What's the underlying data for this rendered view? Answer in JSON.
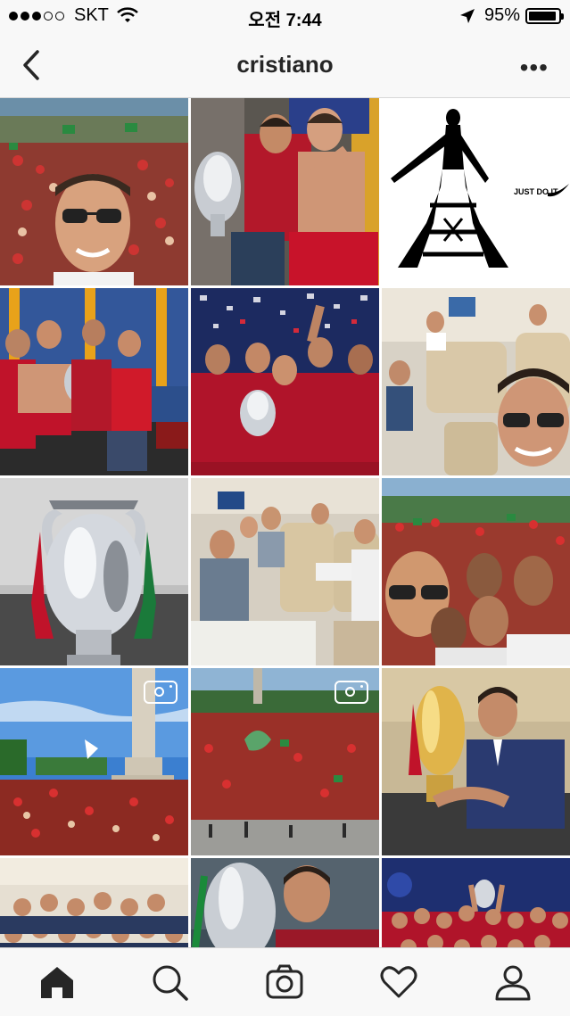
{
  "status_bar": {
    "carrier": "SKT",
    "signal_bars_filled": 3,
    "signal_bars_total": 5,
    "time": "오전 7:44",
    "battery_percent": "95%",
    "battery_level": 0.95,
    "icons": [
      "wifi-icon",
      "location-arrow-icon",
      "battery-icon"
    ]
  },
  "header": {
    "title": "cristiano",
    "back_icon": "chevron-left-icon",
    "more_label": "•••"
  },
  "grid": {
    "posts": [
      {
        "id": "post-1",
        "is_video": false
      },
      {
        "id": "post-2",
        "is_video": false
      },
      {
        "id": "post-3",
        "is_video": false,
        "caption_text": "JUST DO IT"
      },
      {
        "id": "post-4",
        "is_video": false
      },
      {
        "id": "post-5",
        "is_video": false
      },
      {
        "id": "post-6",
        "is_video": false
      },
      {
        "id": "post-7",
        "is_video": false
      },
      {
        "id": "post-8",
        "is_video": false
      },
      {
        "id": "post-9",
        "is_video": false
      },
      {
        "id": "post-10",
        "is_video": true
      },
      {
        "id": "post-11",
        "is_video": true
      },
      {
        "id": "post-12",
        "is_video": false
      },
      {
        "id": "post-13",
        "is_video": false
      },
      {
        "id": "post-14",
        "is_video": false
      },
      {
        "id": "post-15",
        "is_video": false
      }
    ]
  },
  "tab_bar": {
    "tabs": [
      {
        "name": "home",
        "icon": "home-icon",
        "active": true
      },
      {
        "name": "search",
        "icon": "search-icon",
        "active": false
      },
      {
        "name": "camera",
        "icon": "camera-icon",
        "active": false
      },
      {
        "name": "activity",
        "icon": "heart-icon",
        "active": false
      },
      {
        "name": "profile",
        "icon": "profile-icon",
        "active": false
      }
    ]
  },
  "colors": {
    "bar_bg": "#f8f8f8",
    "text": "#262626",
    "portugal_red": "#c8102e",
    "portugal_green": "#046a38"
  }
}
